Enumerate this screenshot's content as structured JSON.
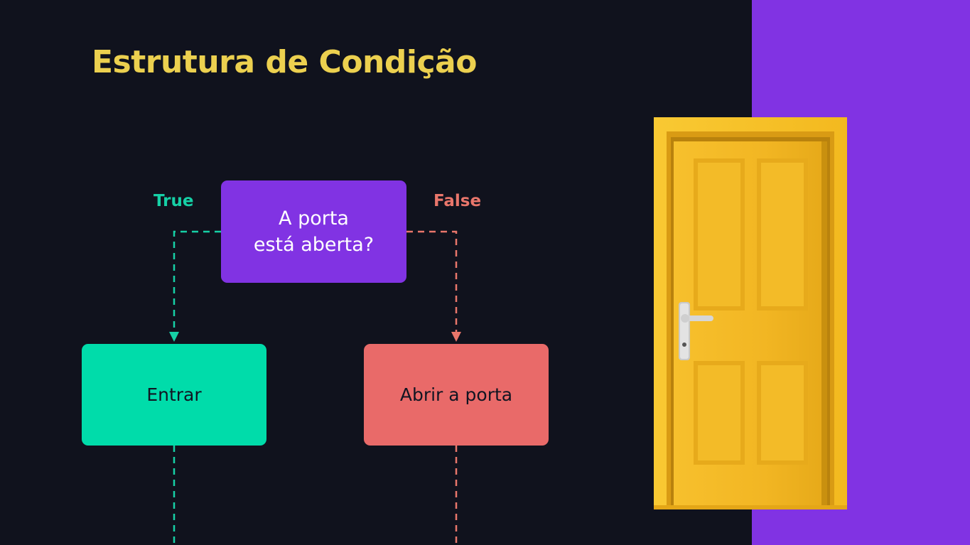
{
  "slide": {
    "title": "Estrutura de Condição"
  },
  "flow": {
    "decision": {
      "line1": "A porta",
      "line2": "está aberta?"
    },
    "true_branch": {
      "label": "True",
      "action": "Entrar"
    },
    "false_branch": {
      "label": "False",
      "action": "Abrir a porta"
    }
  },
  "colors": {
    "background": "#10121d",
    "title": "#ecd04f",
    "decision": "#8133e3",
    "true": "#00dcaa",
    "false": "#e96a69",
    "side_panel": "#8133e3",
    "door": "#f7bf2a"
  },
  "illustration": {
    "icon": "door-icon"
  }
}
